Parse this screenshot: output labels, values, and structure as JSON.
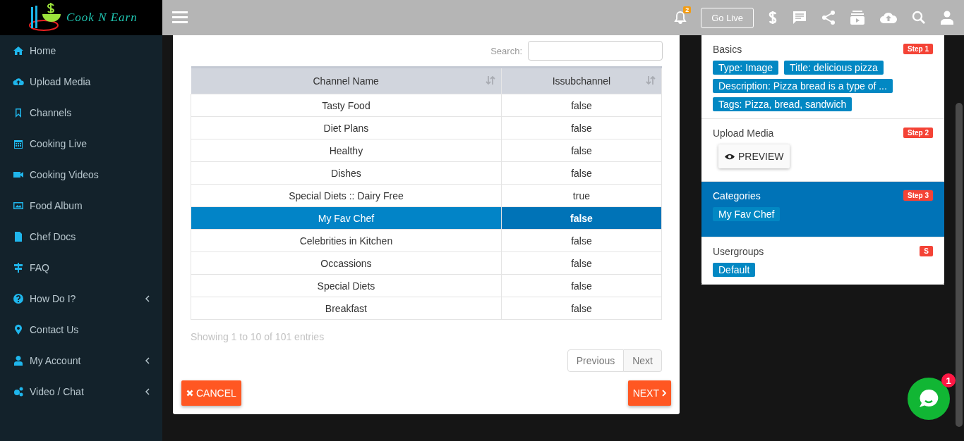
{
  "sidebar": {
    "logo_text": "Cook N Earn",
    "items": [
      {
        "label": "Home",
        "has_submenu": false
      },
      {
        "label": "Upload Media",
        "has_submenu": false
      },
      {
        "label": "Channels",
        "has_submenu": false
      },
      {
        "label": "Cooking Live",
        "has_submenu": false
      },
      {
        "label": "Cooking Videos",
        "has_submenu": false
      },
      {
        "label": "Food Album",
        "has_submenu": false
      },
      {
        "label": "Chef Docs",
        "has_submenu": false
      },
      {
        "label": "FAQ",
        "has_submenu": false
      },
      {
        "label": "How Do I?",
        "has_submenu": true
      },
      {
        "label": "Contact Us",
        "has_submenu": false
      },
      {
        "label": "My Account",
        "has_submenu": true
      },
      {
        "label": "Video / Chat",
        "has_submenu": true
      }
    ]
  },
  "top_bar": {
    "notification_count": "2",
    "go_live": "Go Live"
  },
  "modal": {
    "search_label": "Search:",
    "table": {
      "columns": [
        "Channel Name",
        "Issubchannel"
      ],
      "rows": [
        {
          "cells": [
            "Tasty Food",
            "false"
          ],
          "selected": false
        },
        {
          "cells": [
            "Diet Plans",
            "false"
          ],
          "selected": false
        },
        {
          "cells": [
            "Healthy",
            "false"
          ],
          "selected": false
        },
        {
          "cells": [
            "Dishes",
            "false"
          ],
          "selected": false
        },
        {
          "cells": [
            "Special Diets :: Dairy Free",
            "true"
          ],
          "selected": false
        },
        {
          "cells": [
            "My Fav Chef",
            "false"
          ],
          "selected": true
        },
        {
          "cells": [
            "Celebrities in Kitchen",
            "false"
          ],
          "selected": false
        },
        {
          "cells": [
            "Occassions",
            "false"
          ],
          "selected": false
        },
        {
          "cells": [
            "Special Diets",
            "false"
          ],
          "selected": false
        },
        {
          "cells": [
            "Breakfast",
            "false"
          ],
          "selected": false
        }
      ]
    },
    "info": "Showing 1 to 10 of 101 entries",
    "pagination": [
      "Previous",
      "Next"
    ],
    "cancel": "CANCEL",
    "next": "NEXT"
  },
  "steps": [
    {
      "title": "Basics",
      "step": "Step 1",
      "selected": false,
      "tags": [
        "Type: Image",
        "Title: delicious pizza",
        "Description: Pizza bread is a type of ...",
        "Tags: Pizza, bread, sandwich"
      ]
    },
    {
      "title": "Upload Media",
      "step": "Step 2",
      "selected": false,
      "button": "PREVIEW"
    },
    {
      "title": "Categories",
      "step": "Step 3",
      "selected": true,
      "tags": [
        "My Fav Chef"
      ]
    },
    {
      "title": "Usergroups",
      "step": "S",
      "selected": false,
      "tags": [
        "Default"
      ]
    }
  ],
  "chat": {
    "count": "1"
  }
}
